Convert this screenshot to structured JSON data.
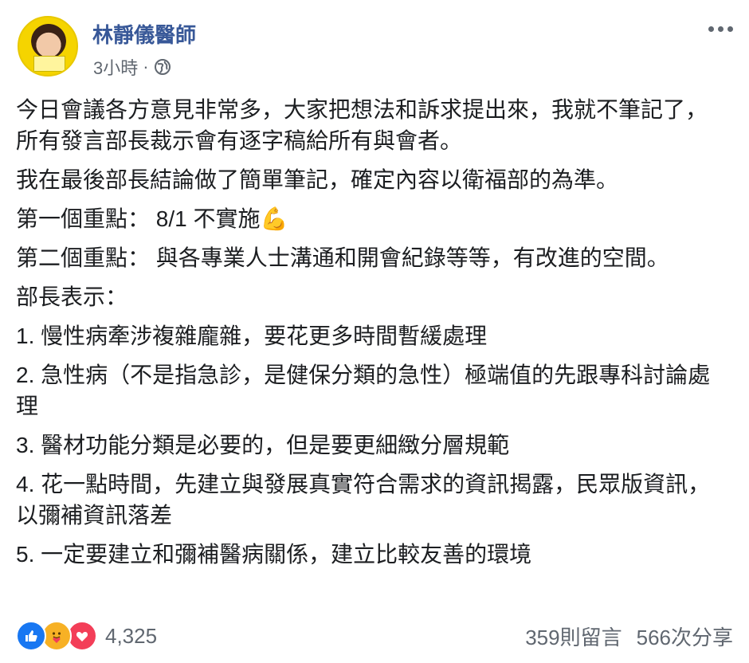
{
  "post": {
    "author": "林靜儀醫師",
    "time": "3小時",
    "separator": "·",
    "privacy_icon": "globe-icon",
    "paragraphs": [
      "今日會議各方意見非常多，大家把想法和訴求提出來，我就不筆記了，所有發言部長裁示會有逐字稿給所有與會者。",
      "我在最後部長結論做了簡單筆記，確定內容以衛福部的為準。",
      "第一個重點： 8/1 不實施💪",
      "第二個重點： 與各專業人士溝通和開會紀錄等等，有改進的空間。",
      "部長表示：",
      "1. 慢性病牽涉複雜龐雜，要花更多時間暫緩處理",
      "2. 急性病（不是指急診，是健保分類的急性）極端值的先跟專科討論處理",
      "3. 醫材功能分類是必要的，但是要更細緻分層規範",
      "4. 花一點時間，先建立與發展真實符合需求的資訊揭露，民眾版資訊，以彌補資訊落差",
      "5. 一定要建立和彌補醫病關係，建立比較友善的環境"
    ]
  },
  "footer": {
    "reactions": [
      "like-icon",
      "care-icon",
      "love-icon"
    ],
    "reaction_count": "4,325",
    "comments": "359則留言",
    "shares": "566次分享"
  },
  "colors": {
    "author": "#385898",
    "muted": "#606770",
    "like": "#1877f2",
    "care": "#f7b125",
    "love": "#f33e58"
  }
}
